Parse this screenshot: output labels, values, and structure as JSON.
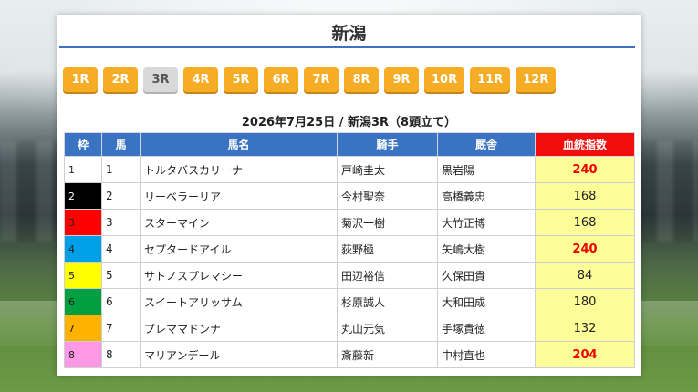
{
  "venue": "新潟",
  "race_tabs": [
    {
      "label": "1R",
      "active": false
    },
    {
      "label": "2R",
      "active": false
    },
    {
      "label": "3R",
      "active": true
    },
    {
      "label": "4R",
      "active": false
    },
    {
      "label": "5R",
      "active": false
    },
    {
      "label": "6R",
      "active": false
    },
    {
      "label": "7R",
      "active": false
    },
    {
      "label": "8R",
      "active": false
    },
    {
      "label": "9R",
      "active": false
    },
    {
      "label": "10R",
      "active": false
    },
    {
      "label": "11R",
      "active": false
    },
    {
      "label": "12R",
      "active": false
    }
  ],
  "race_heading": "2026年7月25日 / 新潟3R（8頭立て）",
  "table": {
    "headers": {
      "waku": "枠",
      "uma": "馬",
      "name": "馬名",
      "jockey": "騎手",
      "trainer": "厩舎",
      "index": "血統指数"
    },
    "rows": [
      {
        "waku": "1",
        "num": "1",
        "name": "トルタバスカリーナ",
        "jockey": "戸崎圭太",
        "trainer": "黒岩陽一",
        "index": "240",
        "waku_color": "#ffffff",
        "waku_text": "#222222",
        "hot": true
      },
      {
        "waku": "2",
        "num": "2",
        "name": "リーベラーリア",
        "jockey": "今村聖奈",
        "trainer": "高橋義忠",
        "index": "168",
        "waku_color": "#000000",
        "waku_text": "#ffffff",
        "hot": false
      },
      {
        "waku": "3",
        "num": "3",
        "name": "スターマイン",
        "jockey": "菊沢一樹",
        "trainer": "大竹正博",
        "index": "168",
        "waku_color": "#ff0000",
        "waku_text": "#222222",
        "hot": false
      },
      {
        "waku": "4",
        "num": "4",
        "name": "セプタードアイル",
        "jockey": "荻野極",
        "trainer": "矢嶋大樹",
        "index": "240",
        "waku_color": "#00a0e9",
        "waku_text": "#222222",
        "hot": true
      },
      {
        "waku": "5",
        "num": "5",
        "name": "サトノスプレマシー",
        "jockey": "田辺裕信",
        "trainer": "久保田貴",
        "index": "84",
        "waku_color": "#ffff00",
        "waku_text": "#222222",
        "hot": false
      },
      {
        "waku": "6",
        "num": "6",
        "name": "スイートアリッサム",
        "jockey": "杉原誠人",
        "trainer": "大和田成",
        "index": "180",
        "waku_color": "#00a040",
        "waku_text": "#222222",
        "hot": false
      },
      {
        "waku": "7",
        "num": "7",
        "name": "プレママドンナ",
        "jockey": "丸山元気",
        "trainer": "手塚貴徳",
        "index": "132",
        "waku_color": "#ffb300",
        "waku_text": "#222222",
        "hot": false
      },
      {
        "waku": "8",
        "num": "8",
        "name": "マリアンデール",
        "jockey": "斎藤新",
        "trainer": "中村直也",
        "index": "204",
        "waku_color": "#ff99e6",
        "waku_text": "#222222",
        "hot": true
      }
    ]
  },
  "colors": {
    "accent_blue": "#3a73c2",
    "tab_orange": "#f6ad25",
    "index_header_red": "#f20d0d",
    "index_cell_yellow": "#fefe99",
    "hot_index_red": "#ee0000"
  }
}
